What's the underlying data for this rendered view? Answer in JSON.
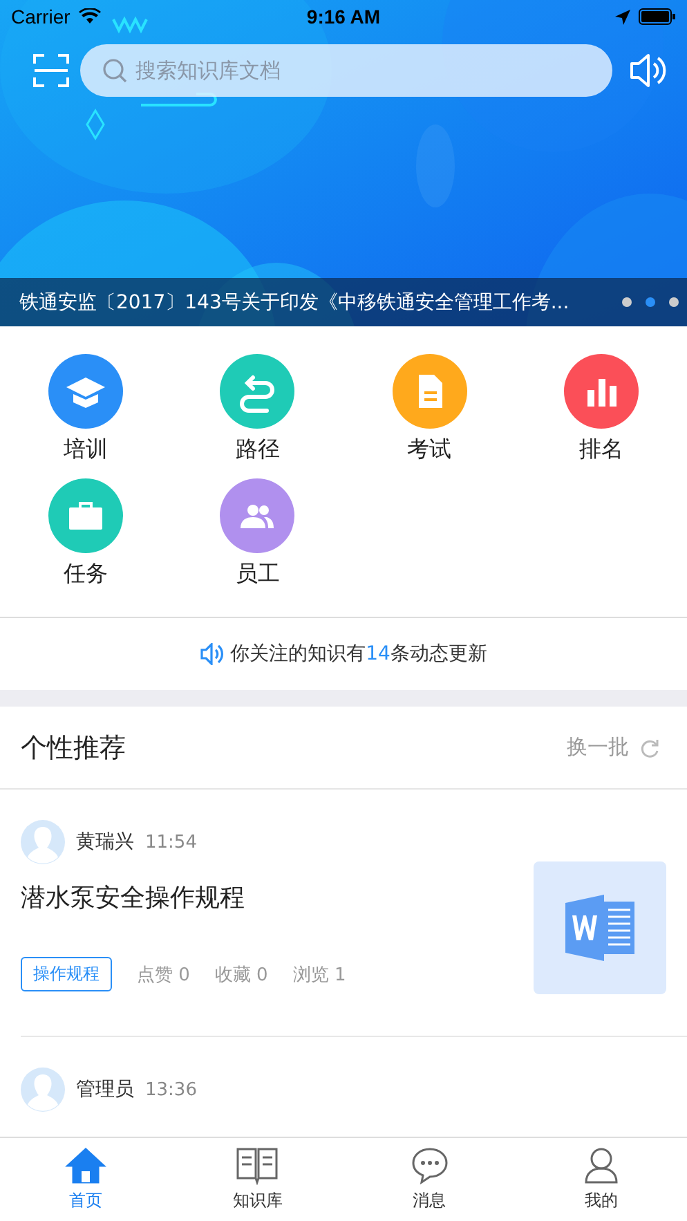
{
  "status_bar": {
    "carrier": "Carrier",
    "time": "9:16 AM"
  },
  "search": {
    "placeholder": "搜索知识库文档"
  },
  "banner": {
    "kind": "picture",
    "caption": "铁通安监〔2017〕143号关于印发《中移铁通安全管理工作考...",
    "pages": [
      {
        "selected": false
      },
      {
        "selected": true
      },
      {
        "selected": false
      }
    ]
  },
  "shortcuts": [
    {
      "label": "培训",
      "kind": "cap",
      "color": "#2a8ff7"
    },
    {
      "label": "路径",
      "kind": "route",
      "color": "#1fcbb6"
    },
    {
      "label": "考试",
      "kind": "doc",
      "color": "#ffa91c"
    },
    {
      "label": "排名",
      "kind": "bars",
      "color": "#fb4f58"
    },
    {
      "label": "任务",
      "kind": "case",
      "color": "#1fcbb6"
    },
    {
      "label": "员工",
      "kind": "people",
      "color": "#b090ee"
    }
  ],
  "notice": {
    "before": "你关注的知识有",
    "count": "14",
    "after": "条动态更新"
  },
  "recommend": {
    "title": "个性推荐",
    "refresh": "换一批",
    "items": [
      {
        "author": "黄瑞兴",
        "time": "11:54",
        "title": "潜水泵安全操作规程",
        "tag": "操作规程",
        "likes": "点赞 0",
        "favorites": "收藏 0",
        "views": "浏览 1",
        "kind": "word"
      },
      {
        "author": "管理员",
        "time": "13:36"
      }
    ]
  },
  "tabs": [
    {
      "label": "首页",
      "kind": "home",
      "selected": true
    },
    {
      "label": "知识库",
      "kind": "book",
      "selected": false
    },
    {
      "label": "消息",
      "kind": "chat",
      "selected": false
    },
    {
      "label": "我的",
      "kind": "user",
      "selected": false
    }
  ]
}
